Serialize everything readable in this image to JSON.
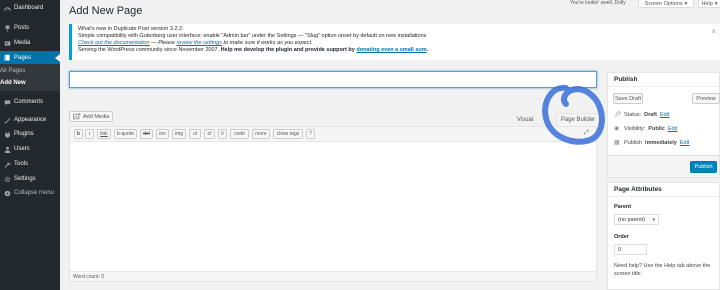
{
  "sidebar": {
    "items": [
      {
        "label": "Dashboard",
        "icon": "dashboard-icon"
      },
      {
        "label": "Posts",
        "icon": "pin-icon"
      },
      {
        "label": "Media",
        "icon": "media-icon"
      },
      {
        "label": "Pages",
        "icon": "pages-icon"
      },
      {
        "label": "All Pages"
      },
      {
        "label": "Add New"
      },
      {
        "label": "Comments",
        "icon": "comment-icon"
      },
      {
        "label": "Appearance",
        "icon": "brush-icon"
      },
      {
        "label": "Plugins",
        "icon": "plugin-icon"
      },
      {
        "label": "Users",
        "icon": "users-icon"
      },
      {
        "label": "Tools",
        "icon": "wrench-icon"
      },
      {
        "label": "Settings",
        "icon": "settings-icon"
      },
      {
        "label": "Collapse menu",
        "icon": "collapse-icon"
      }
    ]
  },
  "header": {
    "title": "Add New Page",
    "greeting": "You're lookin' swell, Dolly",
    "screen_options": "Screen Options",
    "help": "Help"
  },
  "notice": {
    "title": "What's new in Duplicate Post version 3.2.2:",
    "line1": "Simple compatibility with Gutenberg user interface: enable \"Admin bar\" under the Settings — \"Slug\" option unset by default on new installations",
    "line2_link1": "Check out the documentation",
    "line2_mid": " — Please ",
    "line2_link2": "review the settings",
    "line2_end": " to make sure it works as you expect.",
    "line3_start": "Serving the WordPress community since November 2007. ",
    "line3_bold": "Help me develop the plugin and provide support by ",
    "line3_link": "donating even a small sum",
    "line3_end": "."
  },
  "editor": {
    "title_value": "",
    "add_media": "Add Media",
    "tab_visual": "Visual",
    "tab_pagebuilder": "Page Builder",
    "toolbar": [
      "b",
      "i",
      "link",
      "b-quote",
      "del",
      "ins",
      "img",
      "ul",
      "ol",
      "li",
      "code",
      "more",
      "close tags",
      "?"
    ],
    "word_count": "Word count: 0"
  },
  "publish": {
    "heading": "Publish",
    "save_draft": "Save Draft",
    "preview": "Preview",
    "status_label": "Status: ",
    "status_value": "Draft",
    "visibility_label": "Visibility: ",
    "visibility_value": "Public",
    "publish_label": "Publish ",
    "publish_value": "immediately",
    "edit": "Edit",
    "publish_button": "Publish"
  },
  "attributes": {
    "heading": "Page Attributes",
    "parent_label": "Parent",
    "parent_value": "(no parent)",
    "order_label": "Order",
    "order_value": "0",
    "help": "Need help? Use the Help tab above the screen title."
  },
  "colors": {
    "sidebar_bg": "#23282d",
    "accent": "#0073aa",
    "annotation": "#3a6fd8"
  }
}
